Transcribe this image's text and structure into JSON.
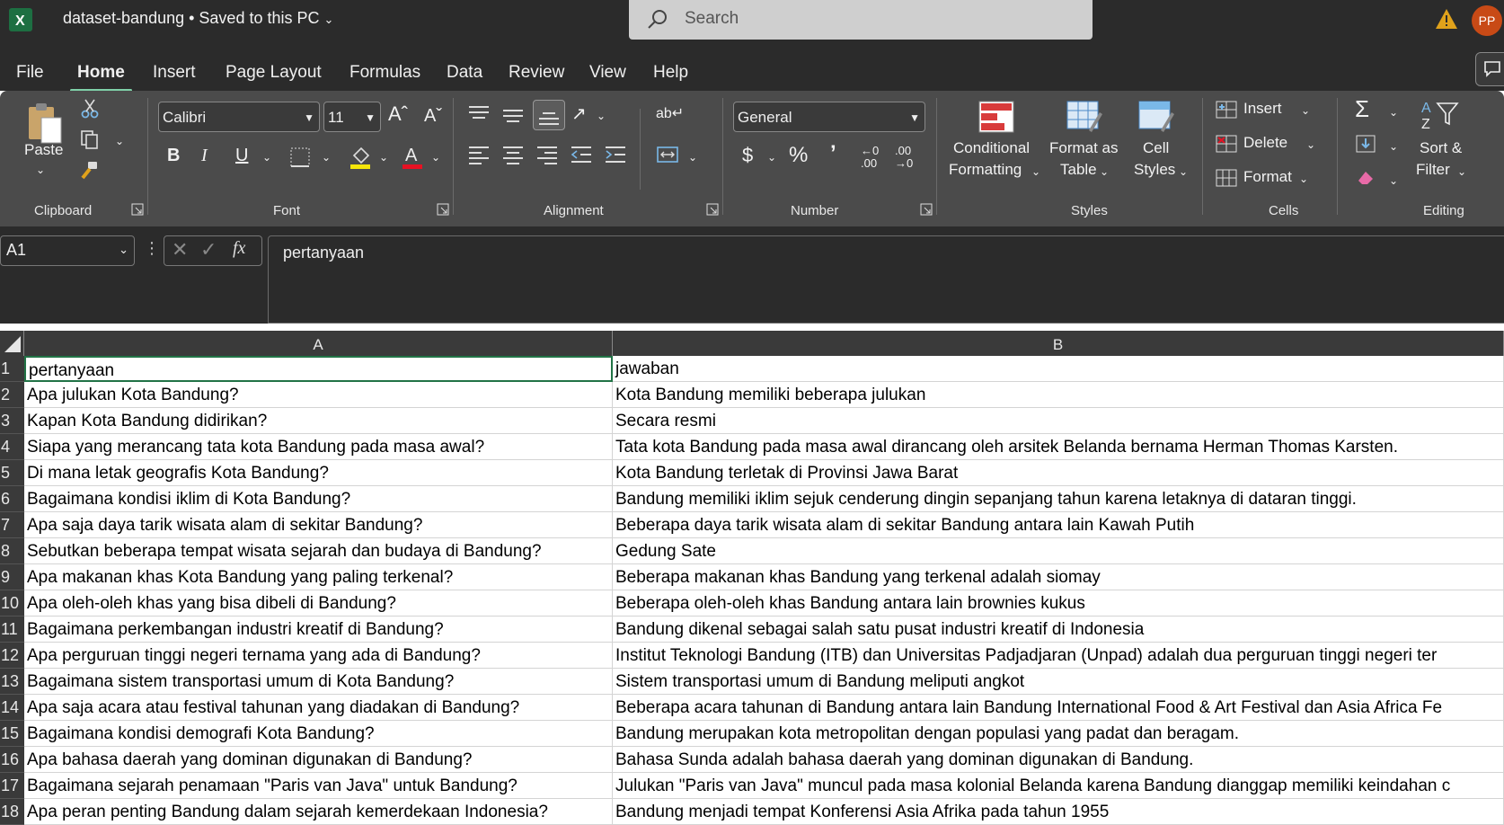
{
  "title_bar": {
    "app_icon": "excel-icon",
    "doc_title": "dataset-bandung • Saved to this PC",
    "search_placeholder": "Search",
    "user_initials": "PP"
  },
  "menu": {
    "items": [
      "File",
      "Home",
      "Insert",
      "Page Layout",
      "Formulas",
      "Data",
      "Review",
      "View",
      "Help"
    ],
    "active": "Home"
  },
  "ribbon": {
    "clipboard": {
      "paste": "Paste",
      "group": "Clipboard"
    },
    "font": {
      "family": "Calibri",
      "size": "11",
      "group": "Font"
    },
    "alignment": {
      "group": "Alignment"
    },
    "number": {
      "format": "General",
      "group": "Number"
    },
    "styles": {
      "conditional_1": "Conditional",
      "conditional_2": "Formatting",
      "format_table_1": "Format as",
      "format_table_2": "Table",
      "cell_styles_1": "Cell",
      "cell_styles_2": "Styles",
      "group": "Styles"
    },
    "cells": {
      "insert": "Insert",
      "delete": "Delete",
      "format": "Format",
      "group": "Cells"
    },
    "editing": {
      "sort_1": "Sort &",
      "sort_2": "Filter",
      "group": "Editing"
    }
  },
  "formula_bar": {
    "name_box": "A1",
    "content": "pertanyaan"
  },
  "sheet": {
    "columns": [
      "A",
      "B"
    ],
    "rows": [
      {
        "n": "1",
        "a": "pertanyaan",
        "b": "jawaban"
      },
      {
        "n": "2",
        "a": "Apa julukan Kota Bandung?",
        "b": "Kota Bandung memiliki beberapa julukan"
      },
      {
        "n": "3",
        "a": "Kapan Kota Bandung didirikan?",
        "b": "Secara resmi"
      },
      {
        "n": "4",
        "a": "Siapa yang merancang tata kota Bandung pada masa awal?",
        "b": "Tata kota Bandung pada masa awal dirancang oleh arsitek Belanda bernama Herman Thomas Karsten."
      },
      {
        "n": "5",
        "a": "Di mana letak geografis Kota Bandung?",
        "b": "Kota Bandung terletak di Provinsi Jawa Barat"
      },
      {
        "n": "6",
        "a": "Bagaimana kondisi iklim di Kota Bandung?",
        "b": "Bandung memiliki iklim sejuk cenderung dingin sepanjang tahun karena letaknya di dataran tinggi."
      },
      {
        "n": "7",
        "a": "Apa saja daya tarik wisata alam di sekitar Bandung?",
        "b": "Beberapa daya tarik wisata alam di sekitar Bandung antara lain Kawah Putih"
      },
      {
        "n": "8",
        "a": "Sebutkan beberapa tempat wisata sejarah dan budaya di Bandung?",
        "b": "Gedung Sate"
      },
      {
        "n": "9",
        "a": "Apa makanan khas Kota Bandung yang paling terkenal?",
        "b": "Beberapa makanan khas Bandung yang terkenal adalah siomay"
      },
      {
        "n": "10",
        "a": "Apa oleh-oleh khas yang bisa dibeli di Bandung?",
        "b": "Beberapa oleh-oleh khas Bandung antara lain brownies kukus"
      },
      {
        "n": "11",
        "a": "Bagaimana perkembangan industri kreatif di Bandung?",
        "b": "Bandung dikenal sebagai salah satu pusat industri kreatif di Indonesia"
      },
      {
        "n": "12",
        "a": "Apa perguruan tinggi negeri ternama yang ada di Bandung?",
        "b": "Institut Teknologi Bandung (ITB) dan Universitas Padjadjaran (Unpad) adalah dua perguruan tinggi negeri ter"
      },
      {
        "n": "13",
        "a": "Bagaimana sistem transportasi umum di Kota Bandung?",
        "b": "Sistem transportasi umum di Bandung meliputi angkot"
      },
      {
        "n": "14",
        "a": "Apa saja acara atau festival tahunan yang diadakan di Bandung?",
        "b": "Beberapa acara tahunan di Bandung antara lain Bandung International Food & Art Festival dan Asia Africa Fe"
      },
      {
        "n": "15",
        "a": "Bagaimana kondisi demografi Kota Bandung?",
        "b": "Bandung merupakan kota metropolitan dengan populasi yang padat dan beragam."
      },
      {
        "n": "16",
        "a": "Apa bahasa daerah yang dominan digunakan di Bandung?",
        "b": "Bahasa Sunda adalah bahasa daerah yang dominan digunakan di Bandung."
      },
      {
        "n": "17",
        "a": "Bagaimana sejarah penamaan \"Paris van Java\" untuk Bandung?",
        "b": "Julukan \"Paris van Java\" muncul pada masa kolonial Belanda karena Bandung dianggap memiliki keindahan c"
      },
      {
        "n": "18",
        "a": "Apa peran penting Bandung dalam sejarah kemerdekaan Indonesia?",
        "b": "Bandung menjadi tempat Konferensi Asia Afrika pada tahun 1955"
      }
    ]
  }
}
